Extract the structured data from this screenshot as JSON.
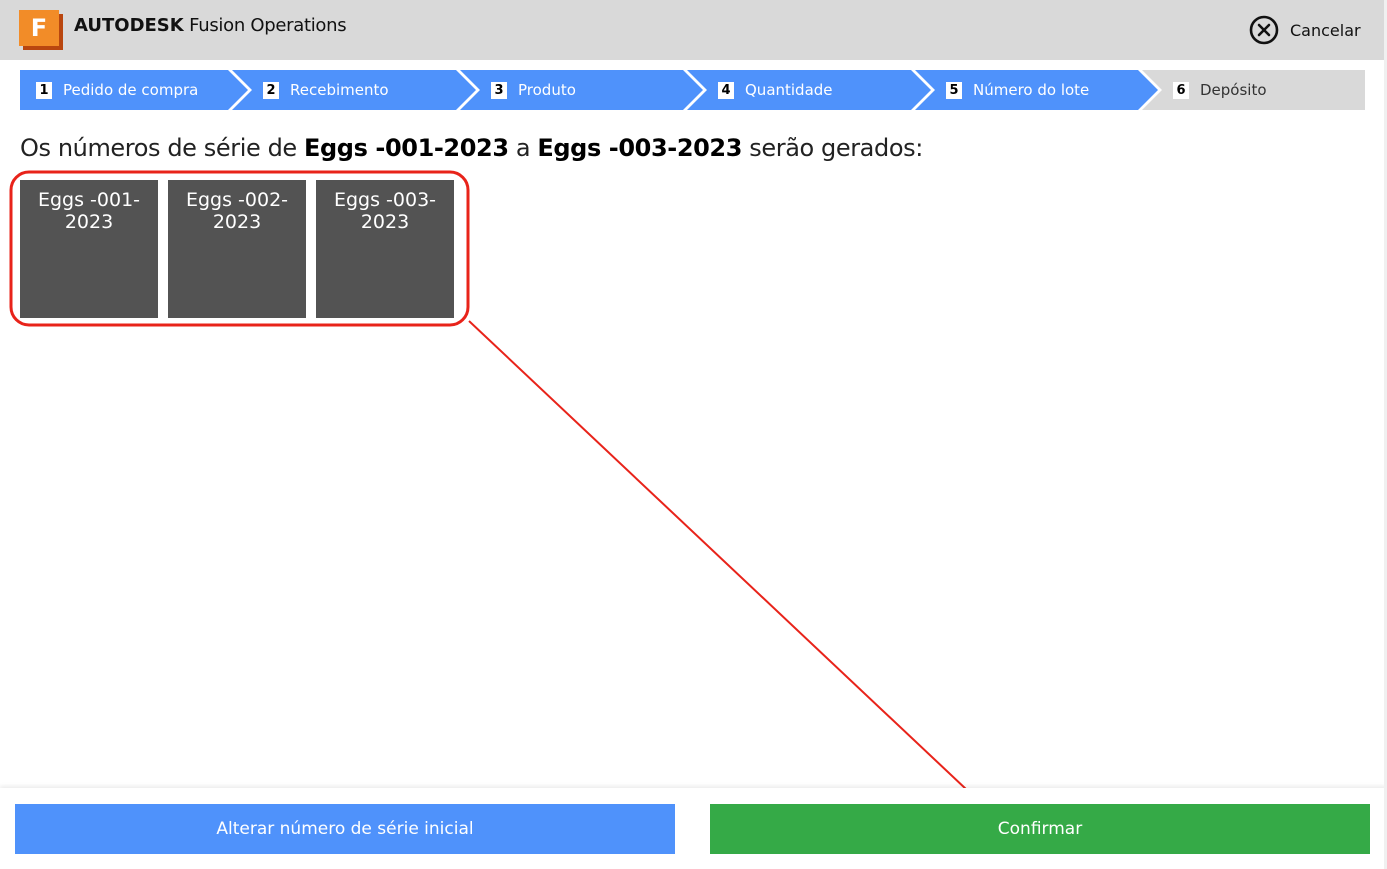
{
  "header": {
    "brand_bold": "AUTODESK",
    "brand_product": "Fusion Operations",
    "logo_letter": "F",
    "logo_icon": "fusion-logo-icon",
    "cancel_label": "Cancelar",
    "cancel_icon": "close-circle-icon"
  },
  "stepper": {
    "active_color": "#4f92fb",
    "inactive_color": "#d9d9d9",
    "steps": [
      {
        "number": "1",
        "label": "Pedido de compra",
        "state": "done"
      },
      {
        "number": "2",
        "label": "Recebimento",
        "state": "done"
      },
      {
        "number": "3",
        "label": "Produto",
        "state": "done"
      },
      {
        "number": "4",
        "label": "Quantidade",
        "state": "done"
      },
      {
        "number": "5",
        "label": "Número do lote",
        "state": "done"
      },
      {
        "number": "6",
        "label": "Depósito",
        "state": "pending"
      }
    ]
  },
  "message": {
    "prefix": "Os números de série de ",
    "from": "Eggs -001-2023",
    "middle": " a ",
    "to": "Eggs -003-2023",
    "suffix": " serão gerados:"
  },
  "serials": [
    {
      "line1": "Eggs -001-",
      "line2": "2023"
    },
    {
      "line1": "Eggs -002-",
      "line2": "2023"
    },
    {
      "line1": "Eggs -003-",
      "line2": "2023"
    }
  ],
  "annotation": {
    "color": "#e8231a",
    "highlight": "serial-tiles",
    "points_to": "confirm-button"
  },
  "footer": {
    "alter_label": "Alterar número de série inicial",
    "confirm_label": "Confirmar",
    "alter_color": "#4f92fb",
    "confirm_color": "#35aa47"
  }
}
